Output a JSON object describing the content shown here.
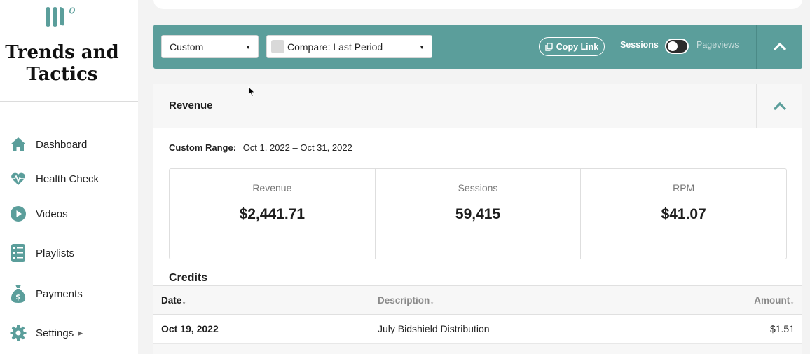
{
  "brand": {
    "name": "Trends and Tactics",
    "logo_icon": "leaf-monogram-icon",
    "accent": "#5b9e9b"
  },
  "sidebar": {
    "items": [
      {
        "label": "Dashboard",
        "icon": "home-icon"
      },
      {
        "label": "Health Check",
        "icon": "heartbeat-icon"
      },
      {
        "label": "Videos",
        "icon": "play-circle-icon"
      },
      {
        "label": "Playlists",
        "icon": "list-icon"
      },
      {
        "label": "Payments",
        "icon": "money-bag-icon"
      },
      {
        "label": "Settings",
        "icon": "gear-icon",
        "has_submenu": true
      }
    ]
  },
  "toolbar": {
    "range_select": "Custom",
    "compare_select": "Compare: Last Period",
    "copy_link_label": "Copy Link",
    "sessions_label": "Sessions",
    "pageviews_label": "Pageviews",
    "toggle_state": "sessions"
  },
  "revenue_panel": {
    "title": "Revenue",
    "range_label": "Custom Range:",
    "range_value": "Oct 1, 2022 – Oct 31, 2022",
    "stats": [
      {
        "label": "Revenue",
        "value": "$2,441.71"
      },
      {
        "label": "Sessions",
        "value": "59,415"
      },
      {
        "label": "RPM",
        "value": "$41.07"
      }
    ],
    "credits": {
      "title": "Credits",
      "columns": {
        "date": "Date↓",
        "description": "Description↓",
        "amount": "Amount↓"
      },
      "rows": [
        {
          "date": "Oct 19, 2022",
          "description": "July Bidshield Distribution",
          "amount": "$1.51"
        }
      ]
    }
  }
}
